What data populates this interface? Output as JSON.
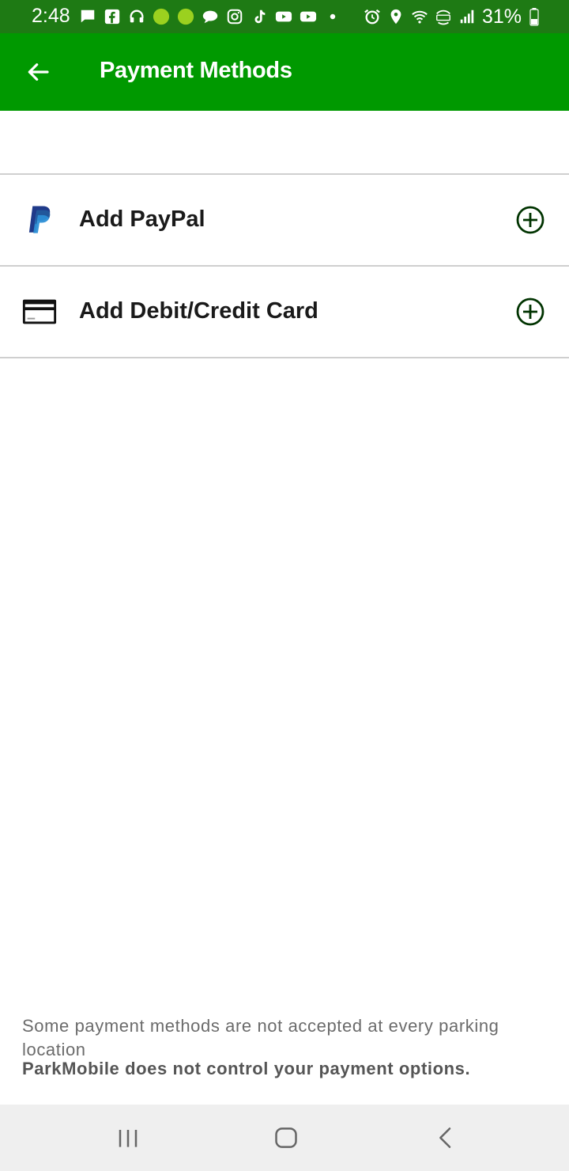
{
  "status_bar": {
    "time": "2:48",
    "battery": "31%",
    "icons": [
      "message-icon",
      "facebook-icon",
      "headphones-icon",
      "app-icon",
      "app-icon",
      "chat-bubble-icon",
      "instagram-icon",
      "tiktok-icon",
      "youtube-icon",
      "youtube-icon",
      "dot-icon",
      "alarm-icon",
      "location-icon",
      "wifi-icon",
      "volte-icon",
      "signal-icon",
      "battery-icon"
    ]
  },
  "app_bar": {
    "title": "Payment Methods",
    "color": "#009900"
  },
  "payment_options": [
    {
      "label": "Add PayPal",
      "icon": "paypal-icon"
    },
    {
      "label": "Add Debit/Credit Card",
      "icon": "credit-card-icon"
    }
  ],
  "footer": {
    "note": "Some payment methods are not accepted at every parking location",
    "note_bold": "ParkMobile does not control your payment options."
  },
  "nav_bar": {
    "buttons": [
      "recent-apps",
      "home",
      "back"
    ]
  }
}
